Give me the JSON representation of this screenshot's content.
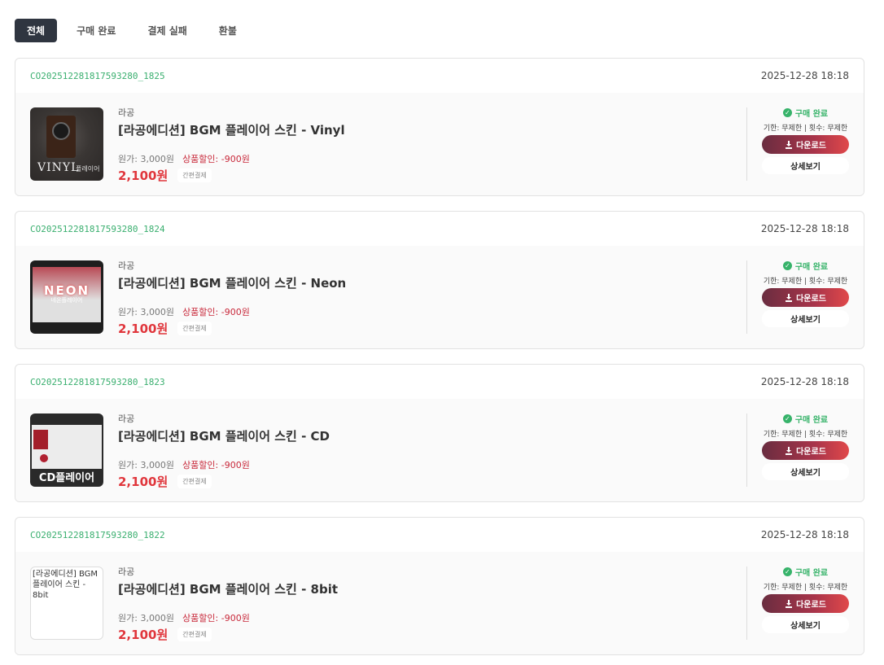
{
  "tabs": [
    {
      "label": "전체",
      "active": true
    },
    {
      "label": "구매 완료",
      "active": false
    },
    {
      "label": "결제 실패",
      "active": false
    },
    {
      "label": "환불",
      "active": false
    }
  ],
  "orders": [
    {
      "order_id": "CO202512281817593280_1825",
      "date": "2025-12-28 18:18",
      "seller": "라공",
      "product_name": "[라공에디션] BGM 플레이어 스킨 - Vinyl",
      "original_price": "원가: 3,000원",
      "discount": "상품할인: -900원",
      "final_price": "2,100원",
      "payment_method": "간편결제",
      "status": "구매 완료",
      "limits": "기한: 무제한 | 횟수: 무제한",
      "download_label": "다운로드",
      "detail_label": "상세보기",
      "thumb": {
        "title": "VINYL",
        "subtitle": "플레이어"
      }
    },
    {
      "order_id": "CO202512281817593280_1824",
      "date": "2025-12-28 18:18",
      "seller": "라공",
      "product_name": "[라공에디션] BGM 플레이어 스킨 - Neon",
      "original_price": "원가: 3,000원",
      "discount": "상품할인: -900원",
      "final_price": "2,100원",
      "payment_method": "간편결제",
      "status": "구매 완료",
      "limits": "기한: 무제한 | 횟수: 무제한",
      "download_label": "다운로드",
      "detail_label": "상세보기",
      "thumb": {
        "title": "NEON",
        "subtitle": "네온플레이어"
      }
    },
    {
      "order_id": "CO202512281817593280_1823",
      "date": "2025-12-28 18:18",
      "seller": "라공",
      "product_name": "[라공에디션] BGM 플레이어 스킨 - CD",
      "original_price": "원가: 3,000원",
      "discount": "상품할인: -900원",
      "final_price": "2,100원",
      "payment_method": "간편결제",
      "status": "구매 완료",
      "limits": "기한: 무제한 | 횟수: 무제한",
      "download_label": "다운로드",
      "detail_label": "상세보기",
      "thumb": {
        "title": "CD플레이어"
      }
    },
    {
      "order_id": "CO202512281817593280_1822",
      "date": "2025-12-28 18:18",
      "seller": "라공",
      "product_name": "[라공에디션] BGM 플레이어 스킨 - 8bit",
      "original_price": "원가: 3,000원",
      "discount": "상품할인: -900원",
      "final_price": "2,100원",
      "payment_method": "간편결제",
      "status": "구매 완료",
      "limits": "기한: 무제한 | 횟수: 무제한",
      "download_label": "다운로드",
      "detail_label": "상세보기",
      "thumb": {
        "alt_text": "[라공에디션] BGM 플레이어 스킨 - 8bit"
      }
    }
  ],
  "colors": {
    "active_tab": "#2f3540",
    "order_id": "#3aaf6f",
    "status_complete": "#37b36a",
    "final_price": "#e0363c",
    "discount": "#c8283a"
  },
  "icons": {
    "status": "check-circle-icon",
    "download": "download-icon"
  }
}
